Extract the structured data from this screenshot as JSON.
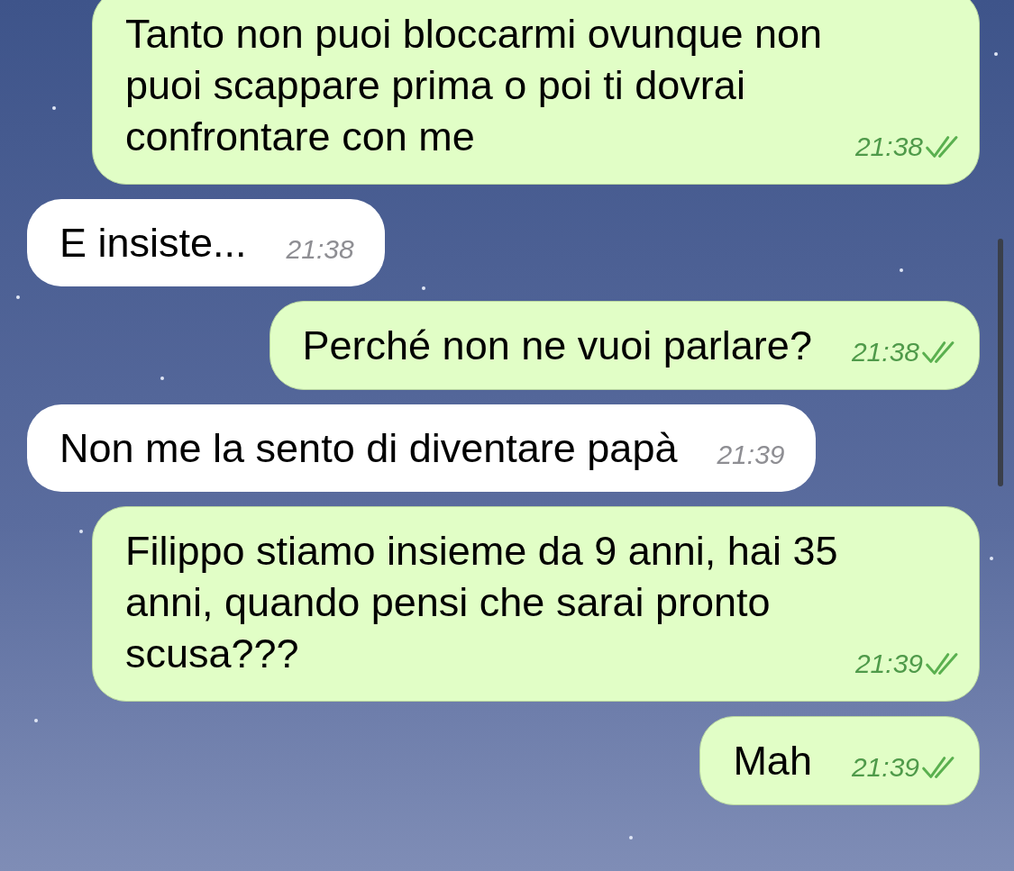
{
  "messages": [
    {
      "kind": "out",
      "text": "Tanto non puoi bloccarmi ovunque non puoi scappare prima o poi ti dovrai confrontare con me",
      "time": "21:38",
      "read": true
    },
    {
      "kind": "in",
      "text": "E insiste...",
      "time": "21:38"
    },
    {
      "kind": "out",
      "text": "Perché non ne vuoi parlare?",
      "time": "21:38",
      "read": true
    },
    {
      "kind": "in",
      "text": "Non me la sento di diventare papà",
      "time": "21:39"
    },
    {
      "kind": "out",
      "text": "Filippo stiamo insieme da 9 anni, hai 35 anni, quando pensi che sarai pronto scusa???",
      "time": "21:39",
      "read": true
    },
    {
      "kind": "out",
      "text": "Mah",
      "time": "21:39",
      "read": true
    }
  ]
}
